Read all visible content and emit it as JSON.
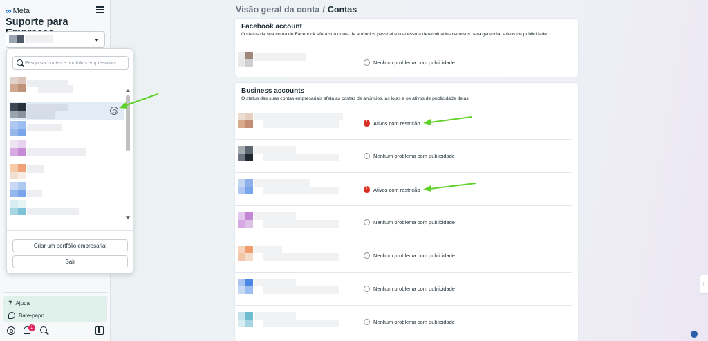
{
  "sidebar": {
    "logo_text": "Meta",
    "logo_mark": "∞",
    "brand": "Suporte para Empresas",
    "dropdown": {
      "search_placeholder": "Pesquisar contas e portfólios empresariais",
      "create_button": "Criar um portfólio empresarial",
      "exit_button": "Sair"
    },
    "help_label": "Ajuda",
    "help_icon": "?",
    "chat_label": "Bate-papo",
    "notification_count": "1"
  },
  "breadcrumb": {
    "parent": "Visão geral da conta",
    "separator": "/",
    "current": "Contas"
  },
  "facebook_account": {
    "title": "Facebook account",
    "description": "O status da sua conta do Facebook afeta sua conta de anúncios pessoal e o acesso a determinados recursos para gerenciar ativos de publicidade.",
    "status": "Nenhum problema com publicidade"
  },
  "business_accounts": {
    "title": "Business accounts",
    "description": "O status das suas contas empresariais afeta as contas de anúncios, as lojas e os ativos de publicidade delas.",
    "rows": [
      {
        "status": "Ativos com restrição",
        "type": "warning"
      },
      {
        "status": "Nenhum problema com publicidade",
        "type": "ok"
      },
      {
        "status": "Ativos com restrição",
        "type": "warning"
      },
      {
        "status": "Nenhum problema com publicidade",
        "type": "ok"
      },
      {
        "status": "Nenhum problema com publicidade",
        "type": "ok"
      },
      {
        "status": "Nenhum problema com publicidade",
        "type": "ok"
      },
      {
        "status": "Nenhum problema com publicidade",
        "type": "ok"
      }
    ]
  },
  "colors": {
    "accent": "#0a66e6",
    "warning": "#d93025",
    "arrow": "#5ed12b",
    "help_bg": "#e0f0ea"
  },
  "icons": [
    "menu-icon",
    "chevron-down-icon",
    "search-icon",
    "gear-icon",
    "help-icon",
    "chat-icon",
    "settings-icon",
    "bell-icon",
    "panel-toggle-icon",
    "radio-circle-icon",
    "warning-icon",
    "globe-icon"
  ]
}
